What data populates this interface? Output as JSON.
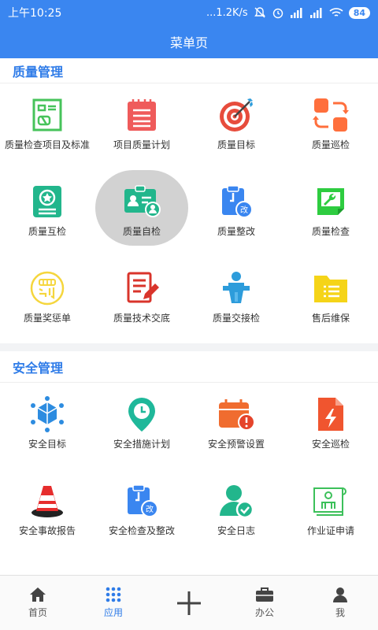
{
  "status": {
    "time": "上午10:25",
    "network": "...1.2K/s",
    "battery": "84"
  },
  "header": {
    "title": "菜单页"
  },
  "quality": {
    "title": "质量管理",
    "items": [
      {
        "label": "质量检查项目及标准",
        "icon": "checklist-icon",
        "color": "#46c35a"
      },
      {
        "label": "项目质量计划",
        "icon": "notepad-icon",
        "color": "#ef5b5b"
      },
      {
        "label": "质量目标",
        "icon": "target-icon",
        "color": "#e74c3c"
      },
      {
        "label": "质量巡检",
        "icon": "patrol-icon",
        "color": "#ff6f3c"
      },
      {
        "label": "质量互检",
        "icon": "star-card-icon",
        "color": "#22b68c"
      },
      {
        "label": "质量自检",
        "icon": "badge-icon",
        "color": "#22b68c"
      },
      {
        "label": "质量整改",
        "icon": "clipboard-fix-icon",
        "color": "#3a86f0"
      },
      {
        "label": "质量检查",
        "icon": "wrench-screen-icon",
        "color": "#2ecc40"
      },
      {
        "label": "质量奖惩单",
        "icon": "reward-penalty-icon",
        "color": "#f5d63d"
      },
      {
        "label": "质量技术交底",
        "icon": "edit-doc-icon",
        "color": "#d9342b"
      },
      {
        "label": "质量交接检",
        "icon": "podium-icon",
        "color": "#2d9cdb"
      },
      {
        "label": "售后维保",
        "icon": "folder-icon",
        "color": "#f5d418"
      }
    ]
  },
  "safety": {
    "title": "安全管理",
    "items": [
      {
        "label": "安全目标",
        "icon": "network-cube-icon",
        "color": "#2d8ce0"
      },
      {
        "label": "安全措施计划",
        "icon": "location-clock-icon",
        "color": "#1fb89a"
      },
      {
        "label": "安全预警设置",
        "icon": "calendar-alert-icon",
        "color": "#f06c2f"
      },
      {
        "label": "安全巡检",
        "icon": "lightning-doc-icon",
        "color": "#f0552f"
      },
      {
        "label": "安全事故报告",
        "icon": "traffic-cone-icon",
        "color": "#e62d2d"
      },
      {
        "label": "安全检查及整改",
        "icon": "clipboard-fix-icon",
        "color": "#3a86f0"
      },
      {
        "label": "安全日志",
        "icon": "user-check-icon",
        "color": "#22b68c"
      },
      {
        "label": "作业证申请",
        "icon": "blueprint-icon",
        "color": "#3cc05a"
      }
    ]
  },
  "tabs": [
    {
      "label": "首页",
      "icon": "home-icon"
    },
    {
      "label": "应用",
      "icon": "apps-grid-icon",
      "active": true
    },
    {
      "label": "",
      "icon": "plus-icon"
    },
    {
      "label": "办公",
      "icon": "briefcase-icon"
    },
    {
      "label": "我",
      "icon": "person-icon"
    }
  ]
}
